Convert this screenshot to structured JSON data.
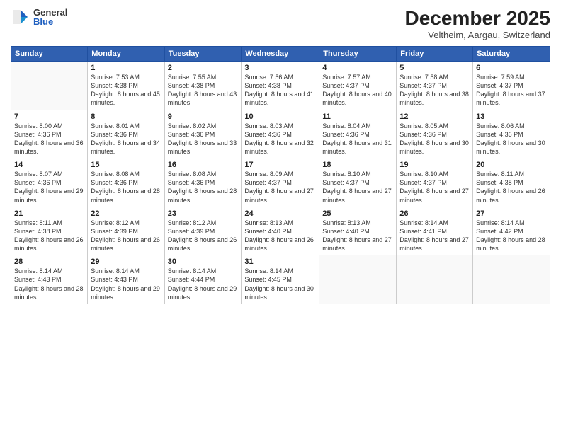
{
  "logo": {
    "general": "General",
    "blue": "Blue"
  },
  "title": "December 2025",
  "location": "Veltheim, Aargau, Switzerland",
  "weekdays": [
    "Sunday",
    "Monday",
    "Tuesday",
    "Wednesday",
    "Thursday",
    "Friday",
    "Saturday"
  ],
  "weeks": [
    [
      {
        "day": "",
        "sunrise": "",
        "sunset": "",
        "daylight": ""
      },
      {
        "day": "1",
        "sunrise": "Sunrise: 7:53 AM",
        "sunset": "Sunset: 4:38 PM",
        "daylight": "Daylight: 8 hours and 45 minutes."
      },
      {
        "day": "2",
        "sunrise": "Sunrise: 7:55 AM",
        "sunset": "Sunset: 4:38 PM",
        "daylight": "Daylight: 8 hours and 43 minutes."
      },
      {
        "day": "3",
        "sunrise": "Sunrise: 7:56 AM",
        "sunset": "Sunset: 4:38 PM",
        "daylight": "Daylight: 8 hours and 41 minutes."
      },
      {
        "day": "4",
        "sunrise": "Sunrise: 7:57 AM",
        "sunset": "Sunset: 4:37 PM",
        "daylight": "Daylight: 8 hours and 40 minutes."
      },
      {
        "day": "5",
        "sunrise": "Sunrise: 7:58 AM",
        "sunset": "Sunset: 4:37 PM",
        "daylight": "Daylight: 8 hours and 38 minutes."
      },
      {
        "day": "6",
        "sunrise": "Sunrise: 7:59 AM",
        "sunset": "Sunset: 4:37 PM",
        "daylight": "Daylight: 8 hours and 37 minutes."
      }
    ],
    [
      {
        "day": "7",
        "sunrise": "Sunrise: 8:00 AM",
        "sunset": "Sunset: 4:36 PM",
        "daylight": "Daylight: 8 hours and 36 minutes."
      },
      {
        "day": "8",
        "sunrise": "Sunrise: 8:01 AM",
        "sunset": "Sunset: 4:36 PM",
        "daylight": "Daylight: 8 hours and 34 minutes."
      },
      {
        "day": "9",
        "sunrise": "Sunrise: 8:02 AM",
        "sunset": "Sunset: 4:36 PM",
        "daylight": "Daylight: 8 hours and 33 minutes."
      },
      {
        "day": "10",
        "sunrise": "Sunrise: 8:03 AM",
        "sunset": "Sunset: 4:36 PM",
        "daylight": "Daylight: 8 hours and 32 minutes."
      },
      {
        "day": "11",
        "sunrise": "Sunrise: 8:04 AM",
        "sunset": "Sunset: 4:36 PM",
        "daylight": "Daylight: 8 hours and 31 minutes."
      },
      {
        "day": "12",
        "sunrise": "Sunrise: 8:05 AM",
        "sunset": "Sunset: 4:36 PM",
        "daylight": "Daylight: 8 hours and 30 minutes."
      },
      {
        "day": "13",
        "sunrise": "Sunrise: 8:06 AM",
        "sunset": "Sunset: 4:36 PM",
        "daylight": "Daylight: 8 hours and 30 minutes."
      }
    ],
    [
      {
        "day": "14",
        "sunrise": "Sunrise: 8:07 AM",
        "sunset": "Sunset: 4:36 PM",
        "daylight": "Daylight: 8 hours and 29 minutes."
      },
      {
        "day": "15",
        "sunrise": "Sunrise: 8:08 AM",
        "sunset": "Sunset: 4:36 PM",
        "daylight": "Daylight: 8 hours and 28 minutes."
      },
      {
        "day": "16",
        "sunrise": "Sunrise: 8:08 AM",
        "sunset": "Sunset: 4:36 PM",
        "daylight": "Daylight: 8 hours and 28 minutes."
      },
      {
        "day": "17",
        "sunrise": "Sunrise: 8:09 AM",
        "sunset": "Sunset: 4:37 PM",
        "daylight": "Daylight: 8 hours and 27 minutes."
      },
      {
        "day": "18",
        "sunrise": "Sunrise: 8:10 AM",
        "sunset": "Sunset: 4:37 PM",
        "daylight": "Daylight: 8 hours and 27 minutes."
      },
      {
        "day": "19",
        "sunrise": "Sunrise: 8:10 AM",
        "sunset": "Sunset: 4:37 PM",
        "daylight": "Daylight: 8 hours and 27 minutes."
      },
      {
        "day": "20",
        "sunrise": "Sunrise: 8:11 AM",
        "sunset": "Sunset: 4:38 PM",
        "daylight": "Daylight: 8 hours and 26 minutes."
      }
    ],
    [
      {
        "day": "21",
        "sunrise": "Sunrise: 8:11 AM",
        "sunset": "Sunset: 4:38 PM",
        "daylight": "Daylight: 8 hours and 26 minutes."
      },
      {
        "day": "22",
        "sunrise": "Sunrise: 8:12 AM",
        "sunset": "Sunset: 4:39 PM",
        "daylight": "Daylight: 8 hours and 26 minutes."
      },
      {
        "day": "23",
        "sunrise": "Sunrise: 8:12 AM",
        "sunset": "Sunset: 4:39 PM",
        "daylight": "Daylight: 8 hours and 26 minutes."
      },
      {
        "day": "24",
        "sunrise": "Sunrise: 8:13 AM",
        "sunset": "Sunset: 4:40 PM",
        "daylight": "Daylight: 8 hours and 26 minutes."
      },
      {
        "day": "25",
        "sunrise": "Sunrise: 8:13 AM",
        "sunset": "Sunset: 4:40 PM",
        "daylight": "Daylight: 8 hours and 27 minutes."
      },
      {
        "day": "26",
        "sunrise": "Sunrise: 8:14 AM",
        "sunset": "Sunset: 4:41 PM",
        "daylight": "Daylight: 8 hours and 27 minutes."
      },
      {
        "day": "27",
        "sunrise": "Sunrise: 8:14 AM",
        "sunset": "Sunset: 4:42 PM",
        "daylight": "Daylight: 8 hours and 28 minutes."
      }
    ],
    [
      {
        "day": "28",
        "sunrise": "Sunrise: 8:14 AM",
        "sunset": "Sunset: 4:43 PM",
        "daylight": "Daylight: 8 hours and 28 minutes."
      },
      {
        "day": "29",
        "sunrise": "Sunrise: 8:14 AM",
        "sunset": "Sunset: 4:43 PM",
        "daylight": "Daylight: 8 hours and 29 minutes."
      },
      {
        "day": "30",
        "sunrise": "Sunrise: 8:14 AM",
        "sunset": "Sunset: 4:44 PM",
        "daylight": "Daylight: 8 hours and 29 minutes."
      },
      {
        "day": "31",
        "sunrise": "Sunrise: 8:14 AM",
        "sunset": "Sunset: 4:45 PM",
        "daylight": "Daylight: 8 hours and 30 minutes."
      },
      {
        "day": "",
        "sunrise": "",
        "sunset": "",
        "daylight": ""
      },
      {
        "day": "",
        "sunrise": "",
        "sunset": "",
        "daylight": ""
      },
      {
        "day": "",
        "sunrise": "",
        "sunset": "",
        "daylight": ""
      }
    ]
  ]
}
